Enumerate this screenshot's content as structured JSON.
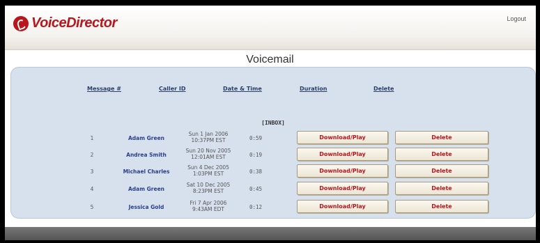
{
  "header": {
    "brand": "VoiceDirector",
    "logout_label": "Logout"
  },
  "page": {
    "title": "Voicemail"
  },
  "columns": {
    "message": "Message #",
    "caller": "Caller ID",
    "datetime": "Date & Time",
    "duration": "Duration",
    "delete": "Delete"
  },
  "folder_label": "[INBOX]",
  "messages": [
    {
      "num": "1",
      "caller": "Adam Green",
      "date": "Sun 1 Jan 2006",
      "time": "10:37PM EST",
      "duration": "0:59",
      "play_label": "Download/Play",
      "delete_label": "Delete"
    },
    {
      "num": "2",
      "caller": "Andrea Smith",
      "date": "Sun 20 Nov 2005",
      "time": "12:01AM EST",
      "duration": "0:19",
      "play_label": "Download/Play",
      "delete_label": "Delete"
    },
    {
      "num": "3",
      "caller": "Michael Charles",
      "date": "Sun 4 Dec 2005",
      "time": "1:03PM EST",
      "duration": "0:38",
      "play_label": "Download/Play",
      "delete_label": "Delete"
    },
    {
      "num": "4",
      "caller": "Adam Green",
      "date": "Sat 10 Dec 2005",
      "time": "8:23PM EST",
      "duration": "0:45",
      "play_label": "Download/Play",
      "delete_label": "Delete"
    },
    {
      "num": "5",
      "caller": "Jessica Gold",
      "date": "Fri 7 Apr 2006",
      "time": "9:43AM EDT",
      "duration": "0:12",
      "play_label": "Download/Play",
      "delete_label": "Delete"
    }
  ],
  "colors": {
    "brand_red": "#b8161c",
    "panel_bg": "#d7e1ed",
    "link_blue": "#2b3f66"
  }
}
